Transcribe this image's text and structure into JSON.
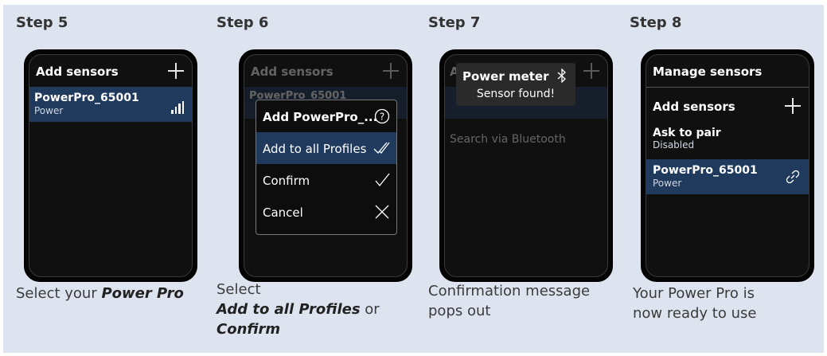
{
  "steps": [
    {
      "title": "Step 5",
      "screen": {
        "header": "Add sensors",
        "row_title": "PowerPro_65001",
        "row_sub": "Power"
      },
      "caption": {
        "text": "Select your ",
        "bold": "Power Pro"
      }
    },
    {
      "title": "Step 6",
      "screen": {
        "header": "Add sensors",
        "bg_row": "PowerPro_65001",
        "menu_title": "Add PowerPro_...",
        "menu": [
          "Add to all Profiles",
          "Confirm",
          "Cancel"
        ]
      },
      "caption": {
        "line1": "Select",
        "bold1": "Add to all Profiles",
        "mid": " or",
        "bold2": "Confirm"
      }
    },
    {
      "title": "Step 7",
      "screen": {
        "popup_title": "Power meter",
        "popup_msg": "Sensor found!",
        "bg_item": "Search via Bluetooth"
      },
      "caption": {
        "line1": "Confirmation message",
        "line2": "pops out"
      }
    },
    {
      "title": "Step 8",
      "screen": {
        "header": "Manage sensors",
        "add": "Add sensors",
        "pair": "Ask to pair",
        "pair_sub": "Disabled",
        "row_title": "PowerPro_65001",
        "row_sub": "Power"
      },
      "caption": {
        "line1": "Your Power Pro is",
        "line2": "now ready to use"
      }
    }
  ]
}
